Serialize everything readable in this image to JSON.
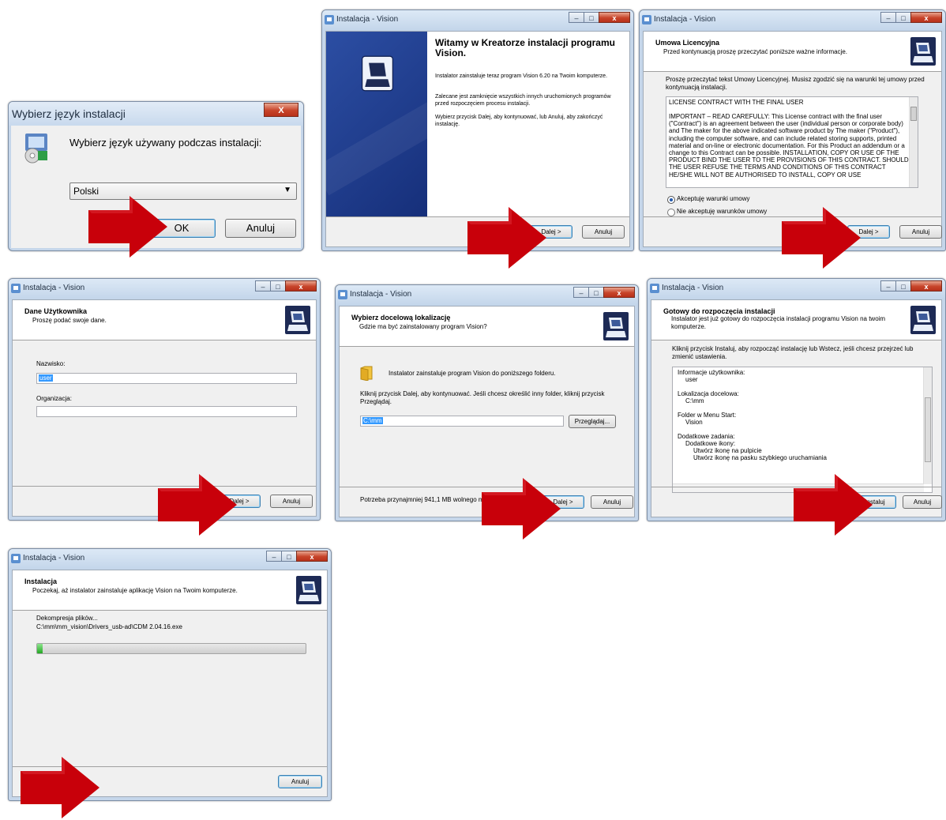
{
  "lang_dialog": {
    "title": "Wybierz język instalacji",
    "prompt": "Wybierz język używany podczas instalacji:",
    "selected_language": "Polski",
    "ok_label": "OK",
    "cancel_label": "Anuluj"
  },
  "welcome": {
    "window_title": "Instalacja - Vision",
    "heading": "Witamy w Kreatorze instalacji programu Vision.",
    "para1": "Instalator zainstaluje teraz program Vision 6.20 na Twoim komputerze.",
    "para2": "Zalecane jest zamknięcie wszystkich innych uruchomionych programów przed rozpoczęciem procesu instalacji.",
    "para3": "Wybierz przycisk Dalej, aby kontynuować, lub Anuluj, aby zakończyć instalację.",
    "next_label": "Dalej >",
    "cancel_label": "Anuluj"
  },
  "license": {
    "window_title": "Instalacja - Vision",
    "header_title": "Umowa Licencyjna",
    "header_sub": "Przed kontynuacją proszę przeczytać poniższe ważne informacje.",
    "intro": "Proszę przeczytać tekst Umowy Licencyjnej. Musisz zgodzić się na warunki tej umowy przed kontynuacją instalacji.",
    "license_heading": "LICENSE CONTRACT WITH THE FINAL USER",
    "license_body": "IMPORTANT – READ CAREFULLY: This License contract with the final user (\"Contract\") is an agreement between the user (individual person or corporate body) and The maker for the above indicated software product by The maker (\"Product\"), including the computer software, and can include related storing supports, printed material and on-line or electronic documentation. For this Product an addendum or a change to this Contract can be possible. INSTALLATION, COPY OR USE OF THE PRODUCT BIND THE USER TO THE PROVISIONS OF THIS CONTRACT. SHOULD THE USER REFUSE THE TERMS AND CONDITIONS OF THIS CONTRACT HE/SHE WILL NOT BE AUTHORISED TO INSTALL, COPY OR USE",
    "accept_label": "Akceptuję warunki umowy",
    "reject_label": "Nie akceptuję warunków umowy",
    "next_label": "Dalej >",
    "cancel_label": "Anuluj"
  },
  "user": {
    "window_title": "Instalacja - Vision",
    "header_title": "Dane Użytkownika",
    "header_sub": "Proszę podać swoje dane.",
    "name_label": "Nazwisko:",
    "name_value": "user",
    "org_label": "Organizacja:",
    "org_value": "",
    "next_label": "Dalej >",
    "cancel_label": "Anuluj"
  },
  "location": {
    "window_title": "Instalacja - Vision",
    "header_title": "Wybierz docelową lokalizację",
    "header_sub": "Gdzie ma być zainstalowany program Vision?",
    "folder_text": "Instalator zainstaluje program Vision do poniższego folderu.",
    "instructions": "Kliknij przycisk Dalej, aby kontynuować. Jeśli chcesz określić inny folder, kliknij przycisk Przeglądaj.",
    "path_value": "C:\\mm",
    "browse_label": "Przeglądaj...",
    "space_text": "Potrzeba przynajmniej 941,1 MB wolnego miejsca na dysku.",
    "next_label": "Dalej >",
    "cancel_label": "Anuluj"
  },
  "ready": {
    "window_title": "Instalacja - Vision",
    "header_title": "Gotowy do rozpoczęcia instalacji",
    "header_sub": "Instalator jest już gotowy do rozpoczęcia instalacji programu Vision na twoim komputerze.",
    "intro": "Kliknij przycisk Instaluj, aby rozpocząć instalację lub Wstecz, jeśli chcesz przejrzeć lub zmienić ustawienia.",
    "summary": [
      {
        "text": "Informacje użytkownika:",
        "indent": 0
      },
      {
        "text": "user",
        "indent": 1
      },
      {
        "text": "",
        "indent": 0
      },
      {
        "text": "Lokalizacja docelowa:",
        "indent": 0
      },
      {
        "text": "C:\\mm",
        "indent": 1
      },
      {
        "text": "",
        "indent": 0
      },
      {
        "text": "Folder w Menu Start:",
        "indent": 0
      },
      {
        "text": "Vision",
        "indent": 1
      },
      {
        "text": "",
        "indent": 0
      },
      {
        "text": "Dodatkowe zadania:",
        "indent": 0
      },
      {
        "text": "Dodatkowe ikony:",
        "indent": 1
      },
      {
        "text": "Utwórz ikonę na pulpicie",
        "indent": 2
      },
      {
        "text": "Utwórz ikonę na pasku szybkiego uruchamiania",
        "indent": 2
      }
    ],
    "install_label": "Instaluj",
    "cancel_label": "Anuluj"
  },
  "installing": {
    "window_title": "Instalacja - Vision",
    "header_title": "Instalacja",
    "header_sub": "Poczekaj, aż instalator zainstaluje aplikację Vision na Twoim komputerze.",
    "status": "Dekompresja plików...",
    "file": "C:\\mm\\mm_vision\\Drivers_usb-ad\\CDM 2.04.16.exe",
    "progress": 0.02,
    "cancel_label": "Anuluj"
  },
  "colors": {
    "arrow": "#c8000a",
    "accent": "#3399ff",
    "welcome_panel": "#1a3a8c",
    "progress_fill": "#3fc43f"
  }
}
